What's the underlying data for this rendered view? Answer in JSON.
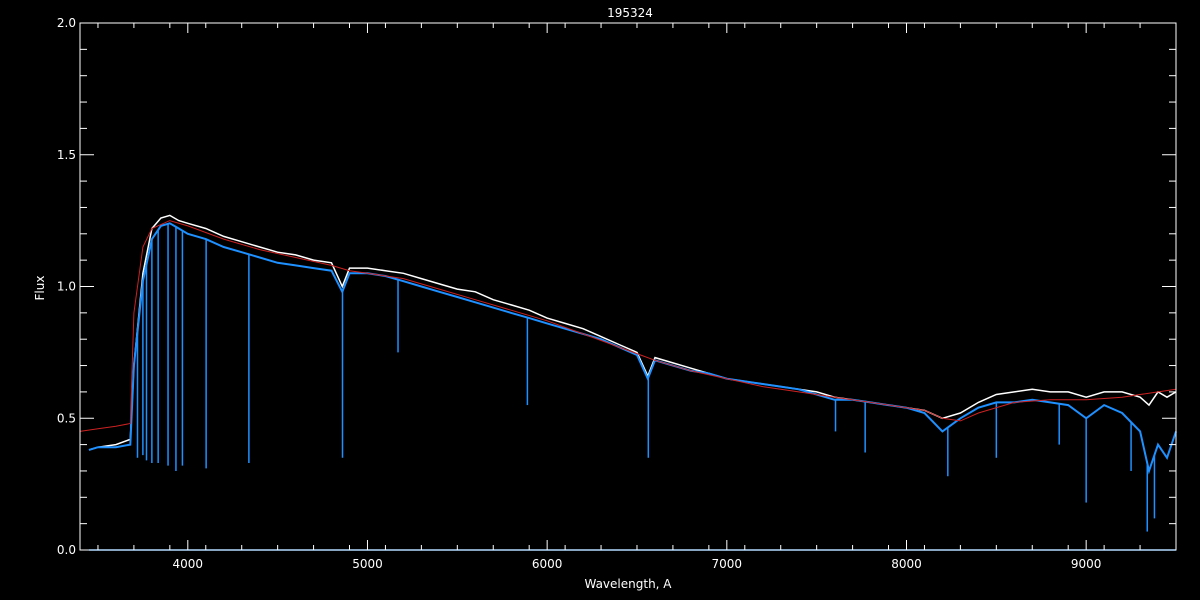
{
  "chart_data": {
    "type": "line",
    "title": "195324",
    "xlabel": "Wavelength, A",
    "ylabel": "Flux",
    "xlim": [
      3400,
      9500
    ],
    "ylim": [
      0,
      2.0
    ],
    "xticks": [
      4000,
      5000,
      6000,
      7000,
      8000,
      9000
    ],
    "xtick_labels": [
      "4000",
      "5000",
      "6000",
      "7000",
      "8000",
      "9000"
    ],
    "yticks": [
      0.0,
      0.5,
      1.0,
      1.5,
      2.0
    ],
    "ytick_labels": [
      "0.0",
      "0.5",
      "1.0",
      "1.5",
      "2.0"
    ],
    "grid": false,
    "colors": {
      "background": "#000000",
      "axes": "#ffffff",
      "observed": "#ffffff",
      "model": "#1e90ff",
      "continuum": "#cc2222",
      "error": "#1e90ff"
    },
    "series": [
      {
        "role": "observed",
        "color": "#ffffff",
        "x": [
          3450,
          3500,
          3600,
          3680,
          3700,
          3750,
          3800,
          3850,
          3900,
          3950,
          4000,
          4100,
          4200,
          4300,
          4400,
          4500,
          4600,
          4700,
          4800,
          4860,
          4900,
          5000,
          5100,
          5200,
          5300,
          5400,
          5500,
          5600,
          5700,
          5800,
          5900,
          6000,
          6100,
          6200,
          6300,
          6400,
          6500,
          6560,
          6600,
          6700,
          6800,
          6900,
          7000,
          7100,
          7200,
          7300,
          7400,
          7500,
          7600,
          7700,
          7800,
          7900,
          8000,
          8100,
          8200,
          8300,
          8400,
          8500,
          8600,
          8700,
          8800,
          8900,
          9000,
          9100,
          9200,
          9300,
          9350,
          9400,
          9450,
          9500
        ],
        "y": [
          0.38,
          0.39,
          0.4,
          0.42,
          0.7,
          1.05,
          1.22,
          1.26,
          1.27,
          1.25,
          1.24,
          1.22,
          1.19,
          1.17,
          1.15,
          1.13,
          1.12,
          1.1,
          1.09,
          1.0,
          1.07,
          1.07,
          1.06,
          1.05,
          1.03,
          1.01,
          0.99,
          0.98,
          0.95,
          0.93,
          0.91,
          0.88,
          0.86,
          0.84,
          0.81,
          0.78,
          0.75,
          0.66,
          0.73,
          0.71,
          0.69,
          0.67,
          0.65,
          0.64,
          0.63,
          0.62,
          0.61,
          0.6,
          0.58,
          0.57,
          0.56,
          0.55,
          0.54,
          0.53,
          0.5,
          0.52,
          0.56,
          0.59,
          0.6,
          0.61,
          0.6,
          0.6,
          0.58,
          0.6,
          0.6,
          0.58,
          0.55,
          0.6,
          0.58,
          0.6
        ]
      },
      {
        "role": "model",
        "color": "#1e90ff",
        "x": [
          3450,
          3500,
          3600,
          3680,
          3700,
          3750,
          3800,
          3850,
          3900,
          3950,
          4000,
          4100,
          4200,
          4300,
          4400,
          4500,
          4600,
          4700,
          4800,
          4860,
          4900,
          5000,
          5100,
          5200,
          5300,
          5400,
          5500,
          5600,
          5700,
          5800,
          5900,
          6000,
          6100,
          6200,
          6300,
          6400,
          6500,
          6560,
          6600,
          6700,
          6800,
          6900,
          7000,
          7100,
          7200,
          7300,
          7400,
          7500,
          7600,
          7700,
          7800,
          7900,
          8000,
          8100,
          8200,
          8300,
          8400,
          8500,
          8600,
          8700,
          8800,
          8900,
          9000,
          9100,
          9200,
          9300,
          9350,
          9400,
          9450,
          9500
        ],
        "y": [
          0.38,
          0.39,
          0.39,
          0.4,
          0.7,
          1.02,
          1.18,
          1.23,
          1.24,
          1.22,
          1.2,
          1.18,
          1.15,
          1.13,
          1.11,
          1.09,
          1.08,
          1.07,
          1.06,
          0.98,
          1.05,
          1.05,
          1.04,
          1.02,
          1.0,
          0.98,
          0.96,
          0.94,
          0.92,
          0.9,
          0.88,
          0.86,
          0.84,
          0.82,
          0.8,
          0.77,
          0.74,
          0.65,
          0.72,
          0.7,
          0.68,
          0.67,
          0.65,
          0.64,
          0.63,
          0.62,
          0.61,
          0.59,
          0.57,
          0.57,
          0.56,
          0.55,
          0.54,
          0.52,
          0.45,
          0.5,
          0.54,
          0.56,
          0.56,
          0.57,
          0.56,
          0.55,
          0.5,
          0.55,
          0.52,
          0.45,
          0.3,
          0.4,
          0.35,
          0.45
        ]
      },
      {
        "role": "continuum",
        "color": "#cc2222",
        "x": [
          3400,
          3500,
          3600,
          3680,
          3700,
          3750,
          3800,
          3900,
          4000,
          4200,
          4400,
          4600,
          4800,
          4900,
          5000,
          5200,
          5400,
          5600,
          5800,
          6000,
          6200,
          6400,
          6600,
          6800,
          7000,
          7200,
          7400,
          7600,
          7800,
          8000,
          8100,
          8200,
          8300,
          8400,
          8600,
          8800,
          9000,
          9200,
          9300,
          9400,
          9500
        ],
        "y": [
          0.45,
          0.46,
          0.47,
          0.48,
          0.9,
          1.15,
          1.22,
          1.25,
          1.23,
          1.18,
          1.14,
          1.11,
          1.08,
          1.06,
          1.05,
          1.03,
          0.99,
          0.95,
          0.91,
          0.87,
          0.82,
          0.77,
          0.72,
          0.68,
          0.65,
          0.62,
          0.6,
          0.58,
          0.56,
          0.54,
          0.53,
          0.5,
          0.49,
          0.52,
          0.56,
          0.57,
          0.57,
          0.58,
          0.59,
          0.6,
          0.61
        ]
      },
      {
        "role": "error",
        "color": "#1e90ff",
        "x": [
          3450,
          9500
        ],
        "y": [
          0.0,
          0.0
        ]
      }
    ],
    "absorption_lines": [
      {
        "x": 3720,
        "depth": 0.35
      },
      {
        "x": 3750,
        "depth": 0.36
      },
      {
        "x": 3770,
        "depth": 0.34
      },
      {
        "x": 3800,
        "depth": 0.33
      },
      {
        "x": 3835,
        "depth": 0.33
      },
      {
        "x": 3890,
        "depth": 0.32
      },
      {
        "x": 3934,
        "depth": 0.3
      },
      {
        "x": 3970,
        "depth": 0.32
      },
      {
        "x": 4102,
        "depth": 0.31
      },
      {
        "x": 4340,
        "depth": 0.33
      },
      {
        "x": 4861,
        "depth": 0.35
      },
      {
        "x": 5170,
        "depth": 0.75
      },
      {
        "x": 5890,
        "depth": 0.55
      },
      {
        "x": 6563,
        "depth": 0.35
      },
      {
        "x": 7605,
        "depth": 0.45
      },
      {
        "x": 7770,
        "depth": 0.37
      },
      {
        "x": 8230,
        "depth": 0.28
      },
      {
        "x": 8500,
        "depth": 0.35
      },
      {
        "x": 8850,
        "depth": 0.4
      },
      {
        "x": 9000,
        "depth": 0.18
      },
      {
        "x": 9250,
        "depth": 0.3
      },
      {
        "x": 9340,
        "depth": 0.07
      },
      {
        "x": 9380,
        "depth": 0.12
      }
    ]
  }
}
